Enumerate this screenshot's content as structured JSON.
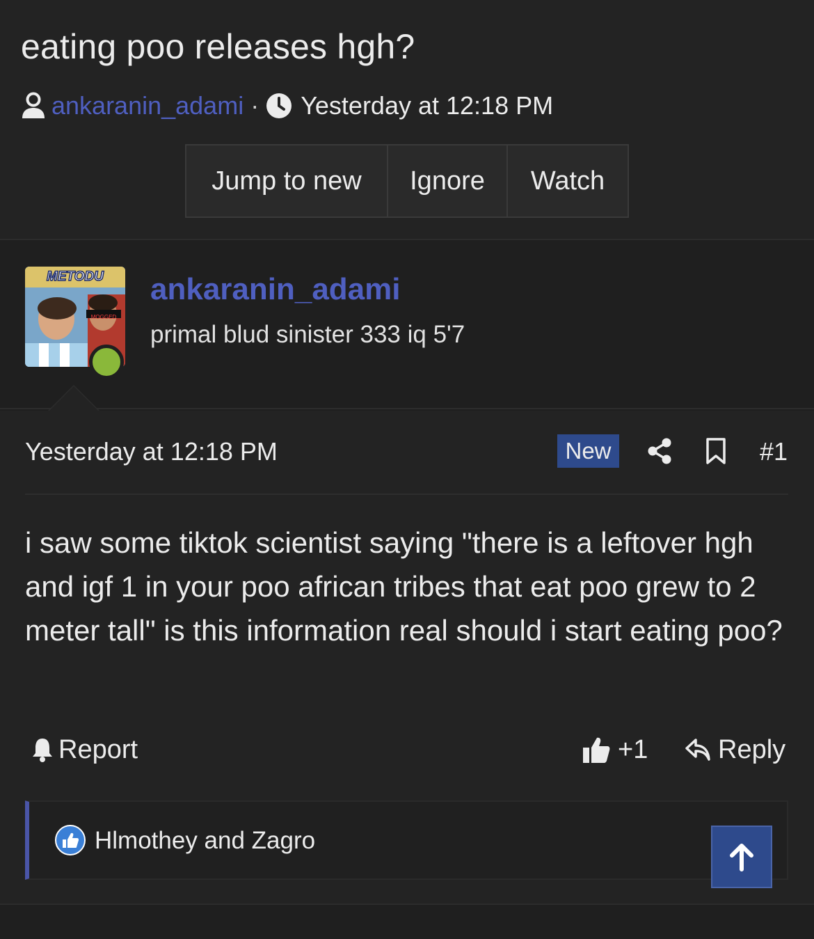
{
  "thread": {
    "title": "eating poo releases hgh?",
    "author": "ankaranin_adami",
    "separator": "·",
    "time": "Yesterday at 12:18 PM"
  },
  "actions": {
    "jump_to_new": "Jump to new",
    "ignore": "Ignore",
    "watch": "Watch"
  },
  "user": {
    "name": "ankaranin_adami",
    "title": "primal blud sinister 333 iq 5'7",
    "avatar_text_top": "METODU",
    "avatar_text_badge": "MOGGED",
    "online": true
  },
  "post": {
    "date": "Yesterday at 12:18 PM",
    "badge": "New",
    "number": "#1",
    "body": "i saw some tiktok scientist saying \"there is a leftover hgh and igf 1 in your poo african tribes that eat poo grew to 2 meter tall\" is this information real should i start eating poo?",
    "report_label": "Report",
    "like_label": "+1",
    "reply_label": "Reply"
  },
  "reactions": {
    "text": "Hlmothey and Zagro"
  },
  "colors": {
    "accent": "#4f5fc0",
    "badge": "#2e4a8c",
    "online": "#8ab83a",
    "background": "#1f1f1f"
  },
  "icons": {
    "user": "user-icon",
    "clock": "clock-icon",
    "share": "share-icon",
    "bookmark": "bookmark-icon",
    "bell": "bell-icon",
    "thumb": "thumbs-up-icon",
    "reply": "reply-arrow-icon",
    "reaction": "like-reaction-icon",
    "scroll_top": "arrow-up-icon"
  }
}
